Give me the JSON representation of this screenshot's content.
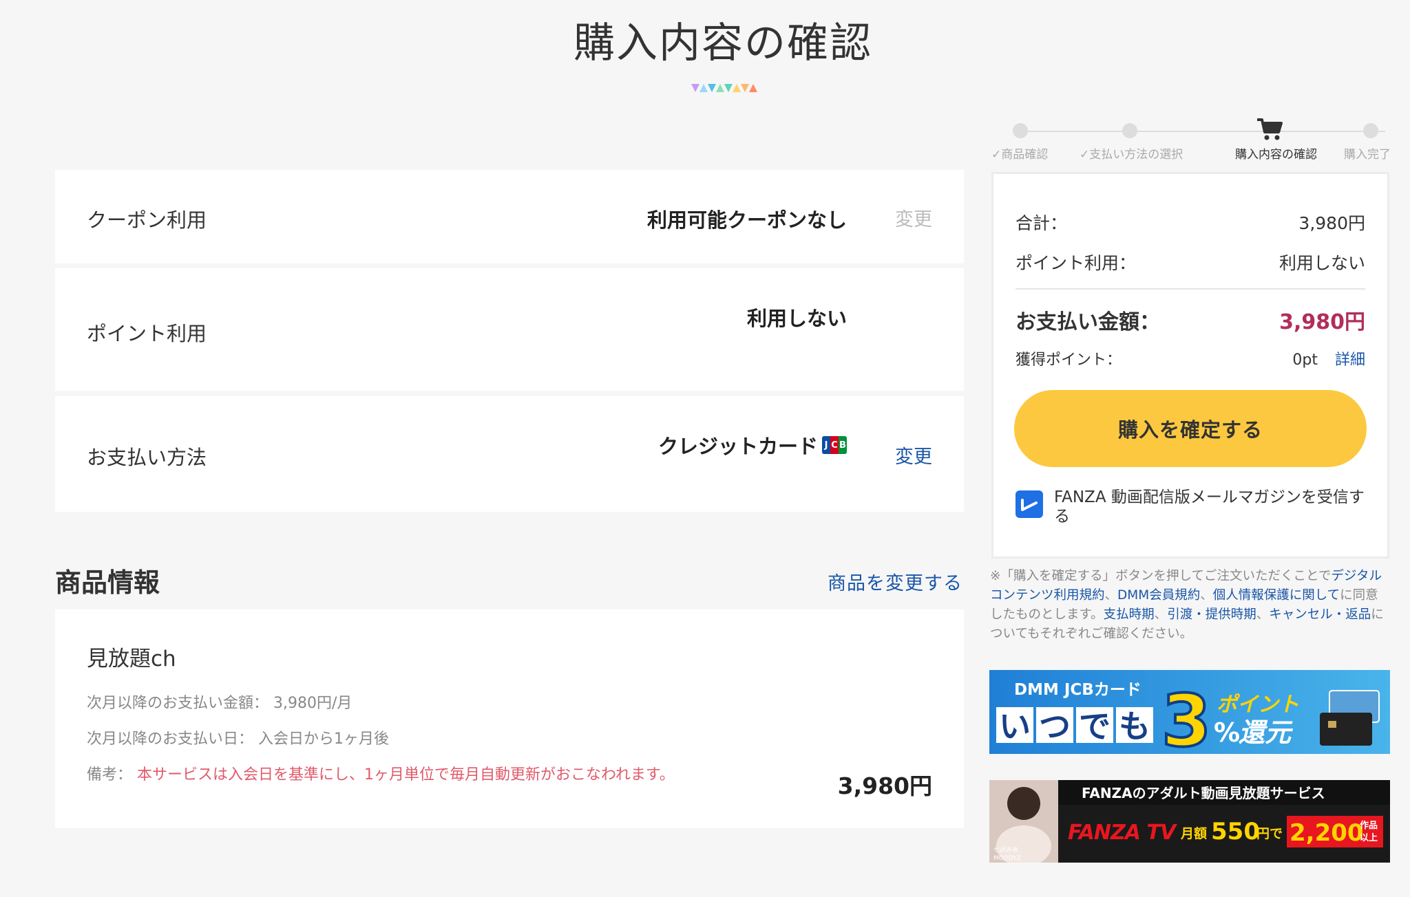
{
  "page": {
    "title": "購入内容の確認"
  },
  "steps": [
    {
      "label": "商品確認",
      "state": "done"
    },
    {
      "label": "支払い方法の選択",
      "state": "done"
    },
    {
      "label": "購入内容の確認",
      "state": "current"
    },
    {
      "label": "購入完了",
      "state": "pending"
    }
  ],
  "coupon": {
    "label": "クーポン利用",
    "value": "利用可能クーポンなし",
    "change_label": "変更"
  },
  "point": {
    "label": "ポイント利用",
    "value": "利用しない"
  },
  "payment": {
    "label": "お支払い方法",
    "value": "クレジットカード",
    "card_brand": "JCB",
    "change_label": "変更"
  },
  "product_section": {
    "title": "商品情報",
    "change_link": "商品を変更する"
  },
  "product": {
    "name": "見放題ch",
    "next_amount_label": "次月以降のお支払い金額：",
    "next_amount_value": "3,980円/月",
    "next_date_label": "次月以降のお支払い日：",
    "next_date_value": "入会日から1ヶ月後",
    "note_label": "備考：",
    "note_value": "本サービスは入会日を基準にし、1ヶ月単位で毎月自動更新がおこなわれます。",
    "price": "3,980円"
  },
  "summary": {
    "total_label": "合計：",
    "total_value": "3,980円",
    "point_label": "ポイント利用：",
    "point_value": "利用しない",
    "pay_label": "お支払い金額：",
    "pay_value": "3,980円",
    "earn_label": "獲得ポイント：",
    "earn_value": "0pt",
    "earn_detail": "詳細",
    "confirm_button": "購入を確定する",
    "magazine_label": "FANZA 動画配信版メールマガジンを受信する",
    "magazine_checked": true
  },
  "legal": {
    "prefix": "※「購入を確定する」ボタンを押してご注文いただくことで",
    "link1": "デジタルコンテンツ利用規約",
    "sep1": "、",
    "link2": "DMM会員規約",
    "sep2": "、",
    "link3": "個人情報保護に関して",
    "mid": "に同意したものとします。",
    "link4": "支払時期",
    "sep3": "、",
    "link5": "引渡・提供時期",
    "sep4": "、",
    "link6": "キャンセル・返品",
    "suffix": "についてもそれぞれご確認ください。"
  },
  "banners": {
    "jcb": {
      "brand": "DMM JCBカード",
      "left_text": "いつでも",
      "big": "3",
      "pct": "%",
      "right_top": "ポイント",
      "right_bottom": "還元"
    },
    "fanza": {
      "top": "FANZAのアダルト動画見放題サービス",
      "logo": "FANZA TV",
      "price_prefix": "月額",
      "price": "550",
      "price_suffix": "円で",
      "count": "2,200",
      "count_suffix_top": "作品",
      "count_suffix_bottom": "以上",
      "caption_line1": "七沢みあ",
      "caption_line2": "MOODYZ"
    }
  },
  "colors": {
    "accent_link": "#1a56a8",
    "price_highlight": "#b22d5b",
    "button": "#fcc83f",
    "note": "#e05a6a"
  }
}
